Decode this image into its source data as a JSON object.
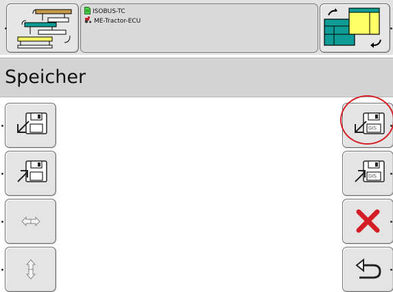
{
  "header": {
    "source_icon": "workset-nav-icon",
    "device_name": "ISOBUS-TC",
    "ecu_name": "ME-Tractor-ECU",
    "target_icon": "change-view-icon"
  },
  "page": {
    "title": "Speicher"
  },
  "left_buttons": [
    {
      "name": "import-button",
      "icon": "floppy-import-icon"
    },
    {
      "name": "export-button",
      "icon": "floppy-export-icon"
    },
    {
      "name": "horizontal-resize-button",
      "icon": "horizontal-arrows-icon"
    },
    {
      "name": "vertical-resize-button",
      "icon": "vertical-arrows-icon"
    }
  ],
  "right_buttons": [
    {
      "name": "import-gis-button",
      "icon": "floppy-gis-import-icon",
      "badge": "GIS",
      "highlighted": true
    },
    {
      "name": "export-gis-button",
      "icon": "floppy-gis-export-icon",
      "badge": "GIS"
    },
    {
      "name": "delete-button",
      "icon": "red-x-icon"
    },
    {
      "name": "back-button",
      "icon": "return-arrow-icon"
    }
  ],
  "colors": {
    "accent_red": "#d21e24",
    "teal": "#0f9c96",
    "yellow": "#ffff66",
    "brown": "#c79a4a"
  }
}
